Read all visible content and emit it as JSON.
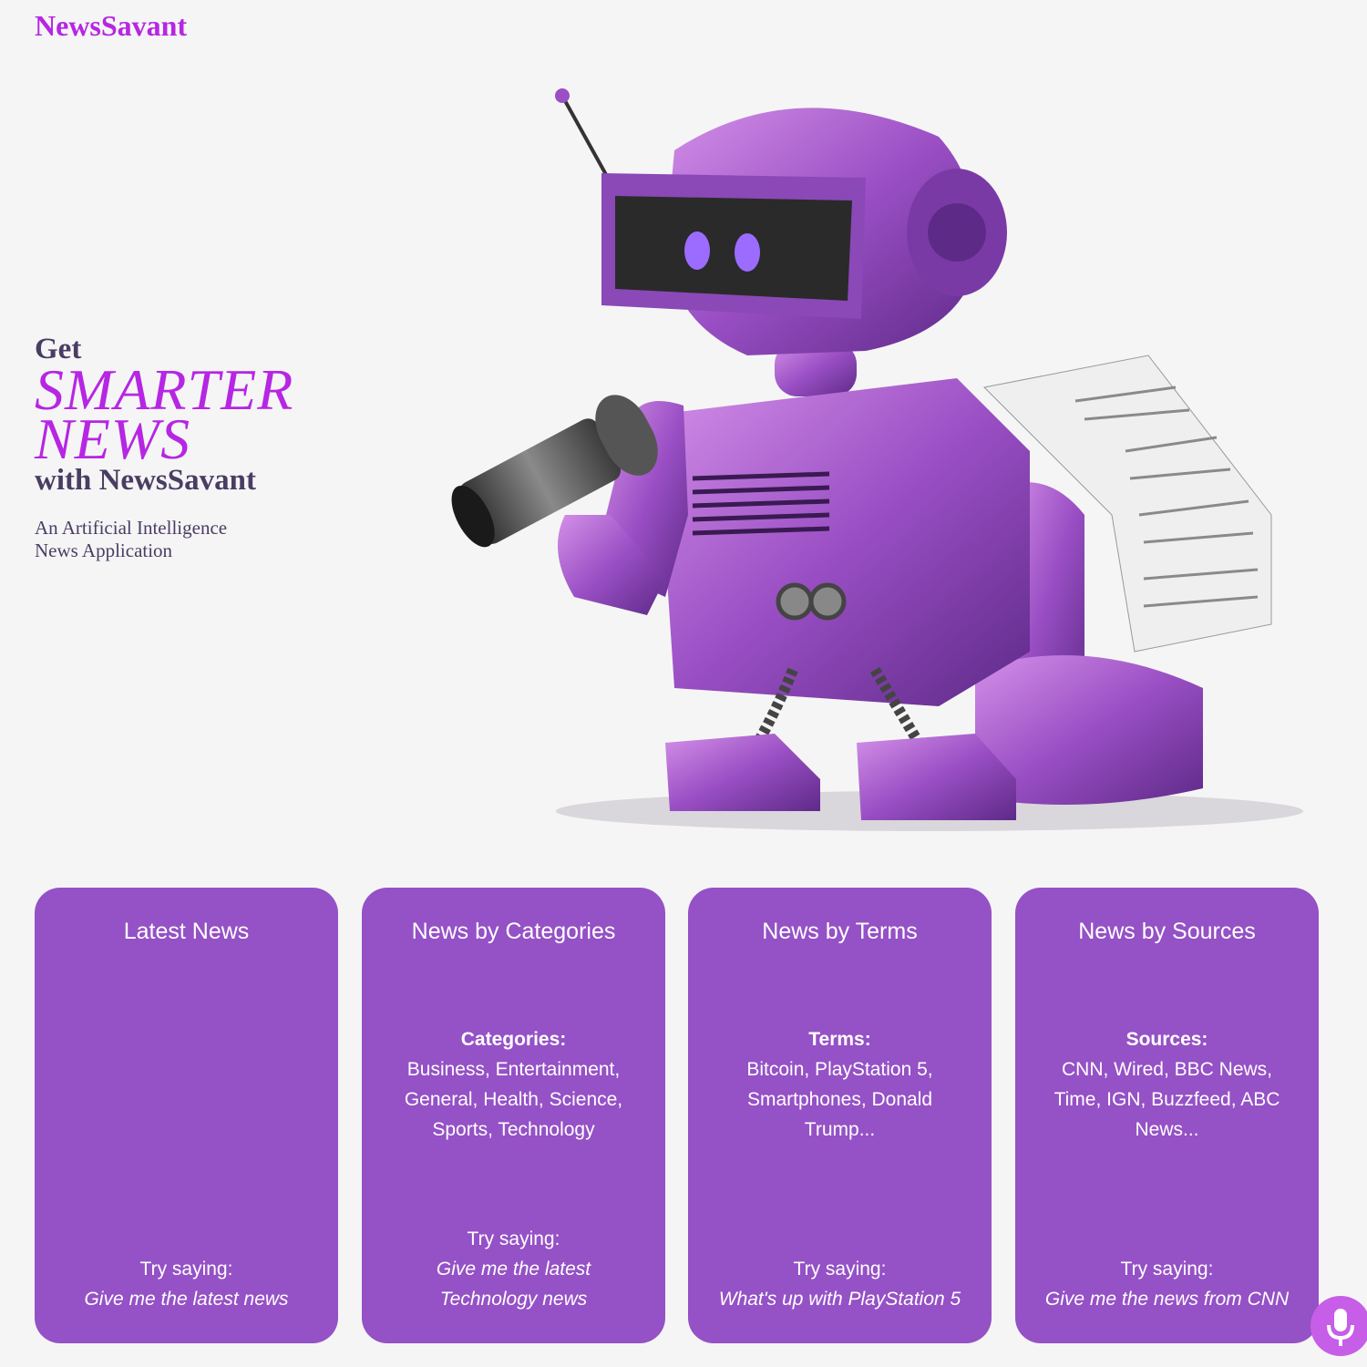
{
  "brand": "NewsSavant",
  "hero": {
    "line1": "Get",
    "line2": "SMARTER",
    "line3": "NEWS",
    "line4": "with NewsSavant",
    "tagline": "An Artificial Intelligence News Application"
  },
  "cards": [
    {
      "title": "Latest News",
      "info_label": "",
      "info_text": "",
      "try_label": "Try saying:",
      "try_example": "Give me the latest news"
    },
    {
      "title": "News by Categories",
      "info_label": "Categories:",
      "info_text": "Business, Entertainment, General, Health, Science, Sports, Technology",
      "try_label": "Try saying:",
      "try_example": "Give me the latest Technology news"
    },
    {
      "title": "News by Terms",
      "info_label": "Terms:",
      "info_text": "Bitcoin, PlayStation 5, Smartphones, Donald Trump...",
      "try_label": "Try saying:",
      "try_example": "What's up with PlayStation 5"
    },
    {
      "title": "News by Sources",
      "info_label": "Sources:",
      "info_text": "CNN, Wired, BBC News, Time, IGN, Buzzfeed, ABC News...",
      "try_label": "Try saying:",
      "try_example": "Give me the news from CNN"
    }
  ],
  "colors": {
    "accent": "#b626e3",
    "card": "#9551c6",
    "heading": "#4a3d63",
    "background": "#f5f5f5",
    "mic": "#c65ee8"
  },
  "icons": {
    "robot": "robot-reporter-illustration",
    "mic": "microphone-icon"
  }
}
